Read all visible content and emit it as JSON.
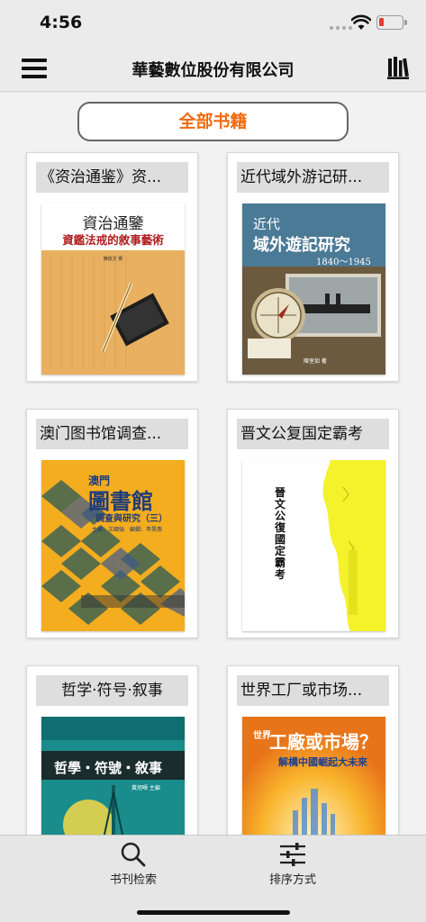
{
  "status_bar": {
    "time": "4:56"
  },
  "nav": {
    "title": "華藝數位股份有限公司",
    "menu_icon": "hamburger-menu-icon",
    "library_icon": "library-books-icon"
  },
  "category_button": {
    "label": "全部书籍"
  },
  "books": [
    {
      "title": "《资治通鉴》资...",
      "cover": {
        "line1": "資治通鑒",
        "line2": "資鑑法戒的敘事藝術",
        "author": "陳俊文 著"
      }
    },
    {
      "title": "近代域外游记研...",
      "cover": {
        "line1": "近代",
        "line2": "域外遊記研究",
        "line3": "1840～1945",
        "author": "陳室如 著"
      }
    },
    {
      "title": "澳门图书馆调查...",
      "cover": {
        "line1": "澳門",
        "line2": "圖書館",
        "line3": "調查與研究（三）",
        "author": "主編：王國強　編輯：李昊燕"
      }
    },
    {
      "title": "晋文公复国定霸考",
      "cover": {
        "line1": "晉文公復國定霸考"
      }
    },
    {
      "title": "哲学·符号·叙事",
      "cover": {
        "line1": "哲學・符號・敘事",
        "author": "黃旭暉 主編"
      }
    },
    {
      "title": "世界工厂或市场...",
      "cover": {
        "line1": "世界",
        "line2": "工廠或市場？",
        "line3": "解構中國崛起大未來"
      }
    }
  ],
  "tabs": [
    {
      "label": "书刊检索",
      "icon": "search-icon"
    },
    {
      "label": "排序方式",
      "icon": "sort-sliders-icon"
    }
  ],
  "colors": {
    "accent": "#f06a10",
    "background": "#ebebeb"
  }
}
